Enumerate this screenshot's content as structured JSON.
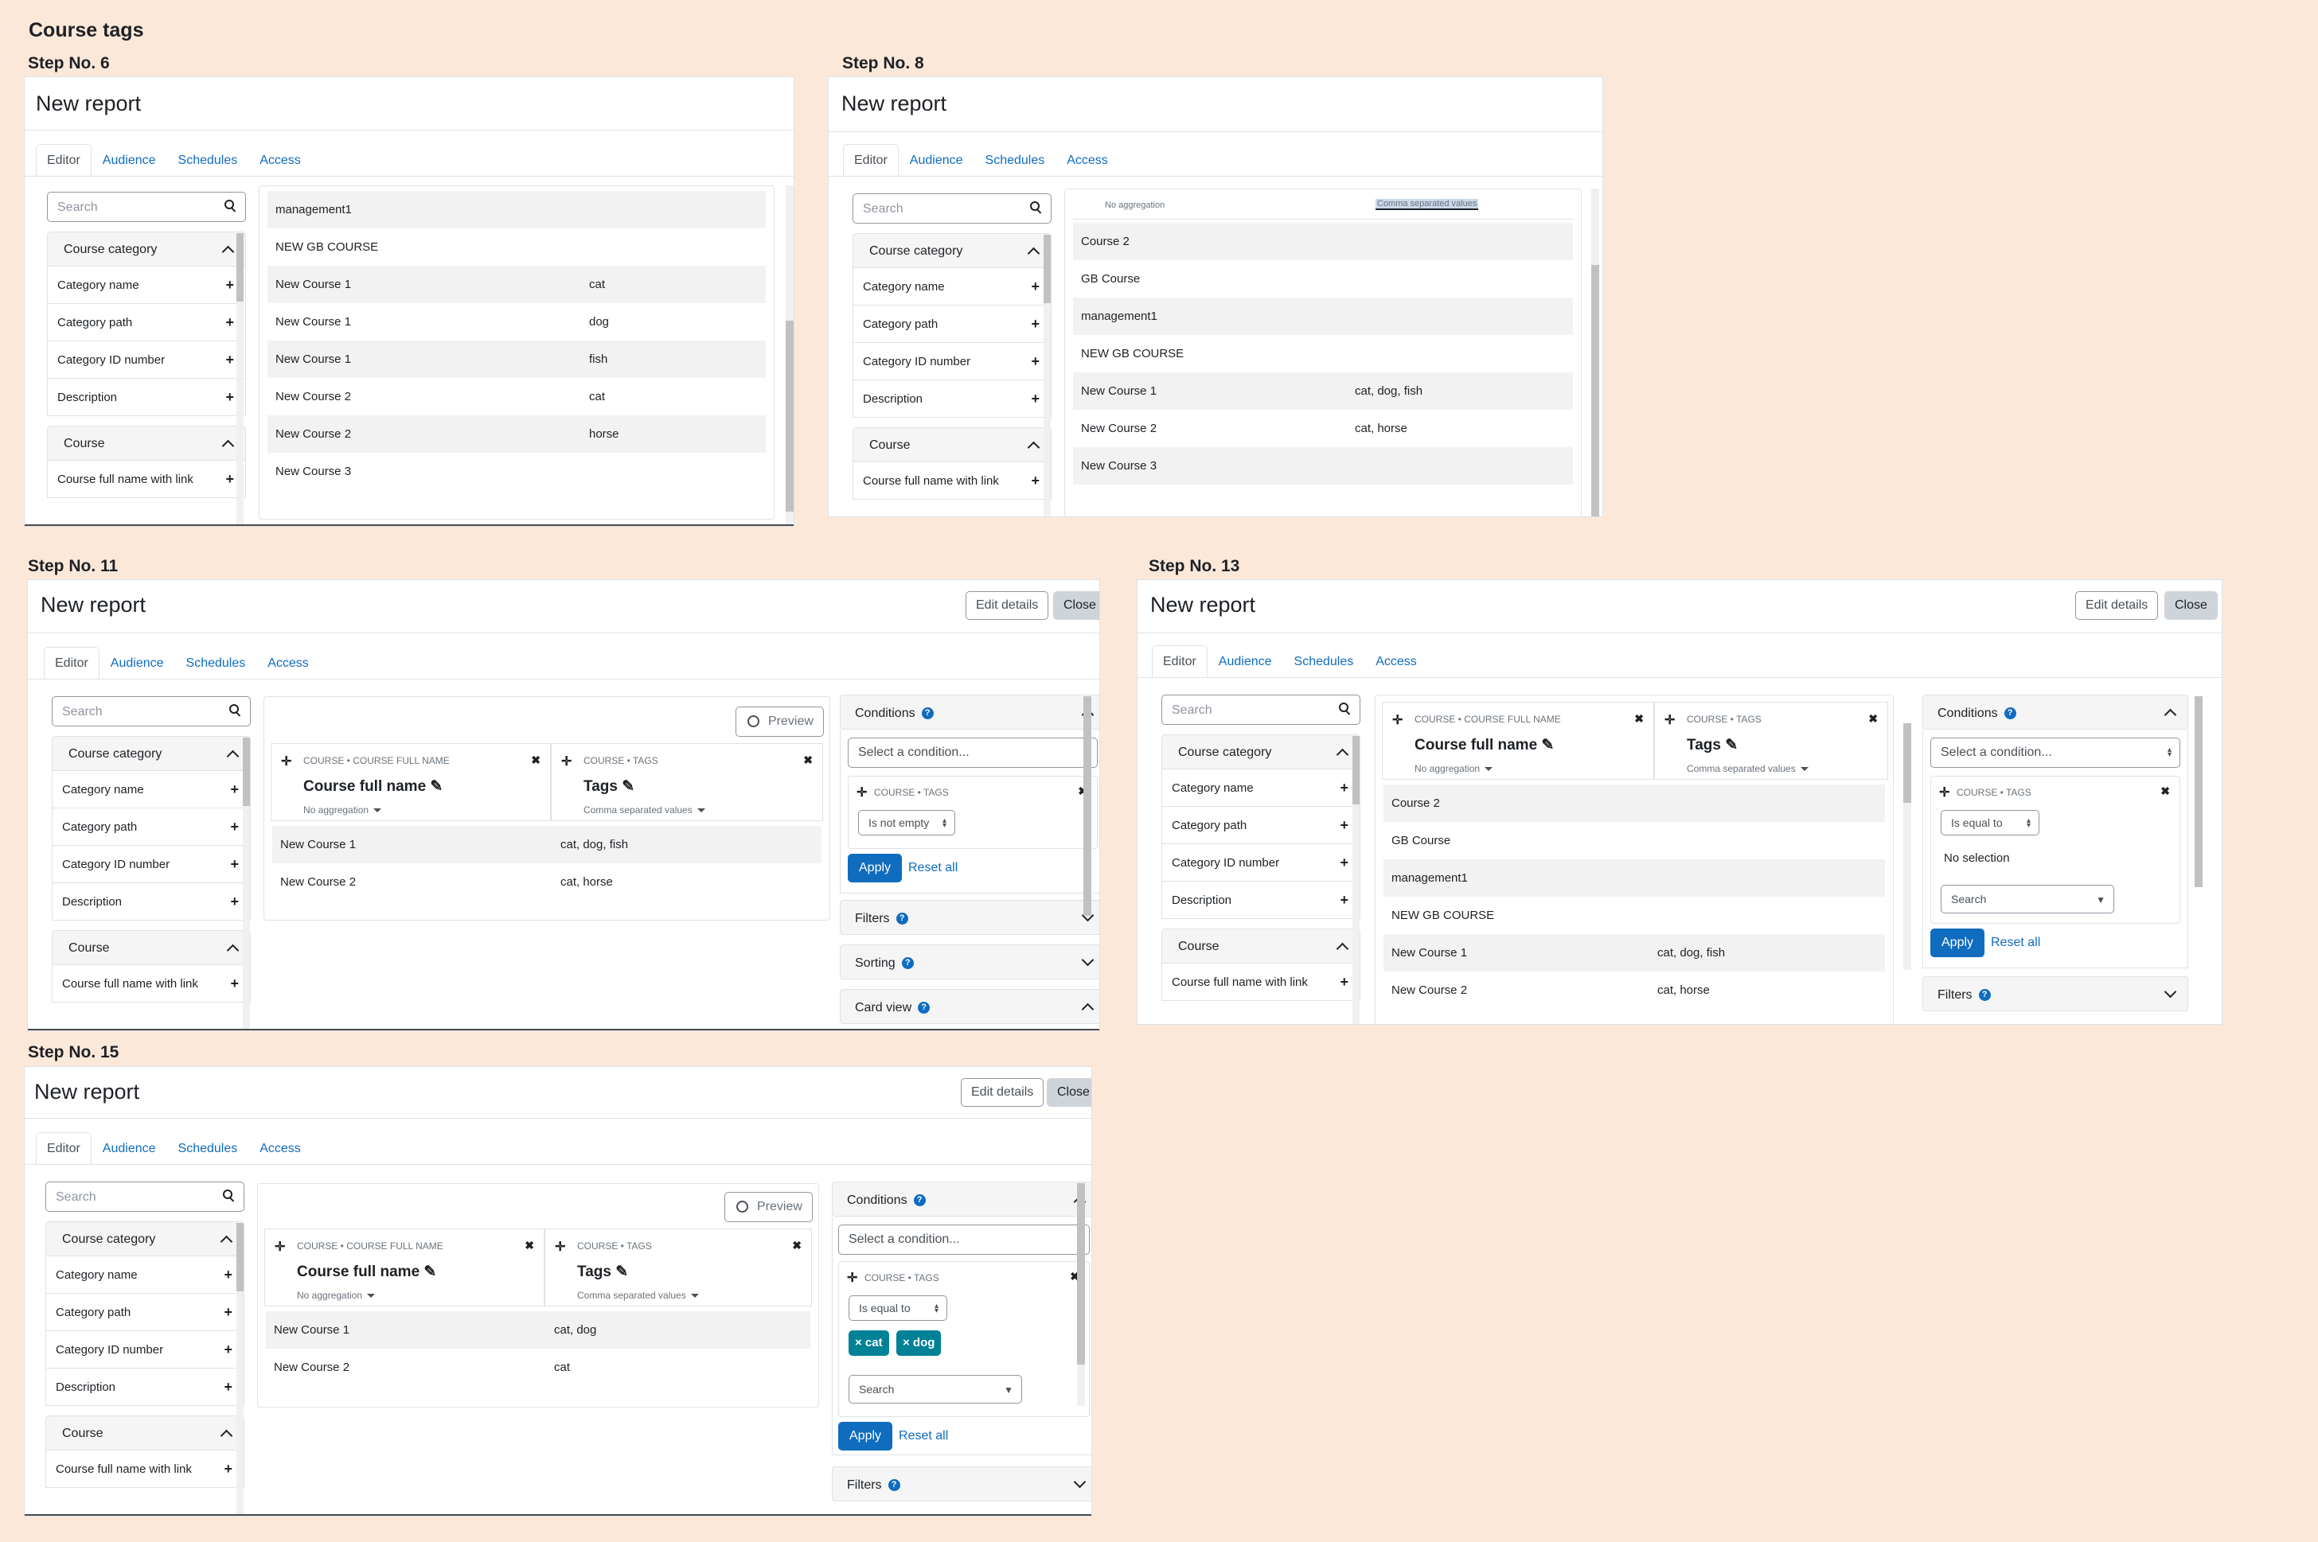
{
  "doc_title": "Course tags",
  "steps": {
    "s6": "Step No. 6",
    "s8": "Step No. 8",
    "s11": "Step No. 11",
    "s13": "Step No. 13",
    "s15": "Step No. 15"
  },
  "report_title": "New report",
  "edit_details": "Edit details",
  "close": "Close",
  "tabs": [
    "Editor",
    "Audience",
    "Schedules",
    "Access"
  ],
  "search_placeholder": "Search",
  "sidebar": {
    "course_category": "Course category",
    "items": [
      "Category name",
      "Category path",
      "Category ID number",
      "Description"
    ],
    "course": "Course",
    "course_item": "Course full name with link"
  },
  "columns": {
    "fullname_cat": "COURSE • COURSE FULL NAME",
    "fullname": "Course full name",
    "tags_cat": "COURSE • TAGS",
    "tags": "Tags",
    "no_aggregation": "No aggregation",
    "csv": "Comma separated values"
  },
  "preview": "Preview",
  "conditions": {
    "title": "Conditions",
    "select": "Select a condition...",
    "card_cat": "COURSE • TAGS",
    "not_empty": "Is not empty",
    "equal_to": "Is equal to",
    "no_selection": "No selection",
    "apply": "Apply",
    "reset": "Reset all",
    "filters": "Filters",
    "sorting": "Sorting",
    "card_view": "Card view",
    "pill_cat": "× cat",
    "pill_dog": "× dog"
  },
  "s6_rows": [
    [
      "management1",
      ""
    ],
    [
      "NEW GB COURSE",
      ""
    ],
    [
      "New Course 1",
      "cat"
    ],
    [
      "New Course 1",
      "dog"
    ],
    [
      "New Course 1",
      "fish"
    ],
    [
      "New Course 2",
      "cat"
    ],
    [
      "New Course 2",
      "horse"
    ],
    [
      "New Course 3",
      ""
    ]
  ],
  "s8_rows": [
    [
      "Course 2",
      ""
    ],
    [
      "GB Course",
      ""
    ],
    [
      "management1",
      ""
    ],
    [
      "NEW GB COURSE",
      ""
    ],
    [
      "New Course 1",
      "cat, dog, fish"
    ],
    [
      "New Course 2",
      "cat, horse"
    ],
    [
      "New Course 3",
      ""
    ]
  ],
  "s11_rows": [
    [
      "New Course 1",
      "cat, dog, fish"
    ],
    [
      "New Course 2",
      "cat, horse"
    ]
  ],
  "s13_rows": [
    [
      "Course 2",
      ""
    ],
    [
      "GB Course",
      ""
    ],
    [
      "management1",
      ""
    ],
    [
      "NEW GB COURSE",
      ""
    ],
    [
      "New Course 1",
      "cat, dog, fish"
    ],
    [
      "New Course 2",
      "cat, horse"
    ]
  ],
  "s15_rows": [
    [
      "New Course 1",
      "cat, dog"
    ],
    [
      "New Course 2",
      "cat"
    ]
  ]
}
